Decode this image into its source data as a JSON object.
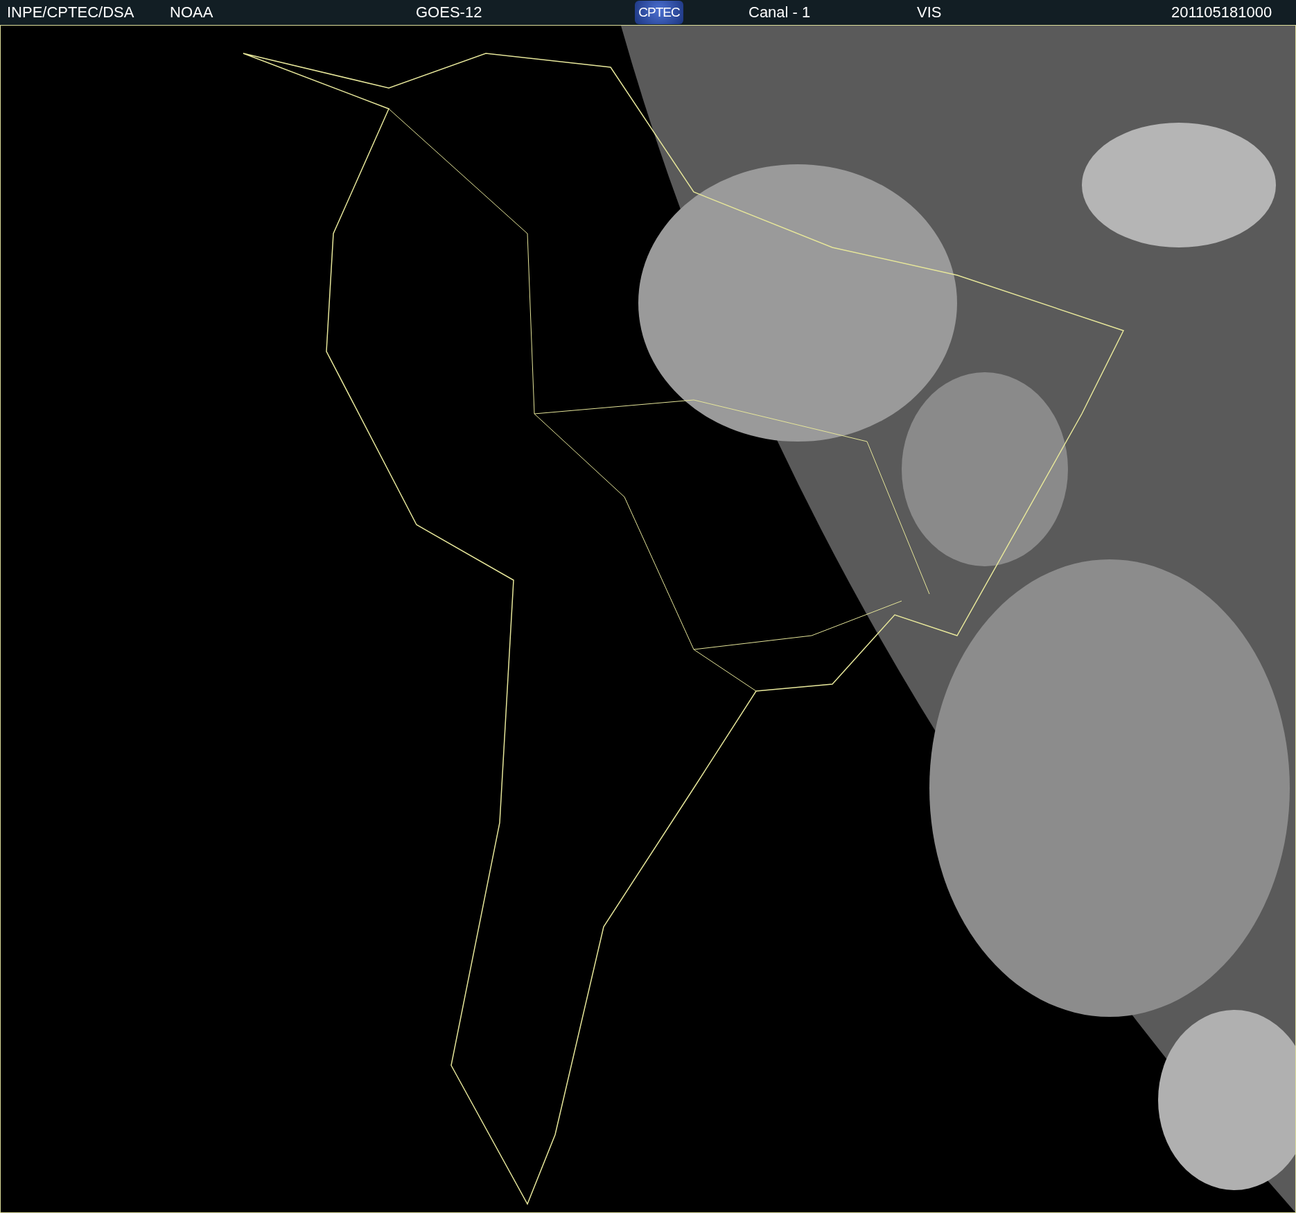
{
  "header": [
    {
      "kind": "text",
      "text": "INPE/CPTEC/DSA"
    },
    {
      "kind": "text",
      "text": "NOAA"
    },
    {
      "kind": "text",
      "text": "GOES-12"
    },
    {
      "kind": "logo",
      "text": "CPTEC"
    },
    {
      "kind": "text",
      "text": "Canal - 1"
    },
    {
      "kind": "text",
      "text": "VIS"
    },
    {
      "kind": "text",
      "text": "201105181000"
    }
  ]
}
